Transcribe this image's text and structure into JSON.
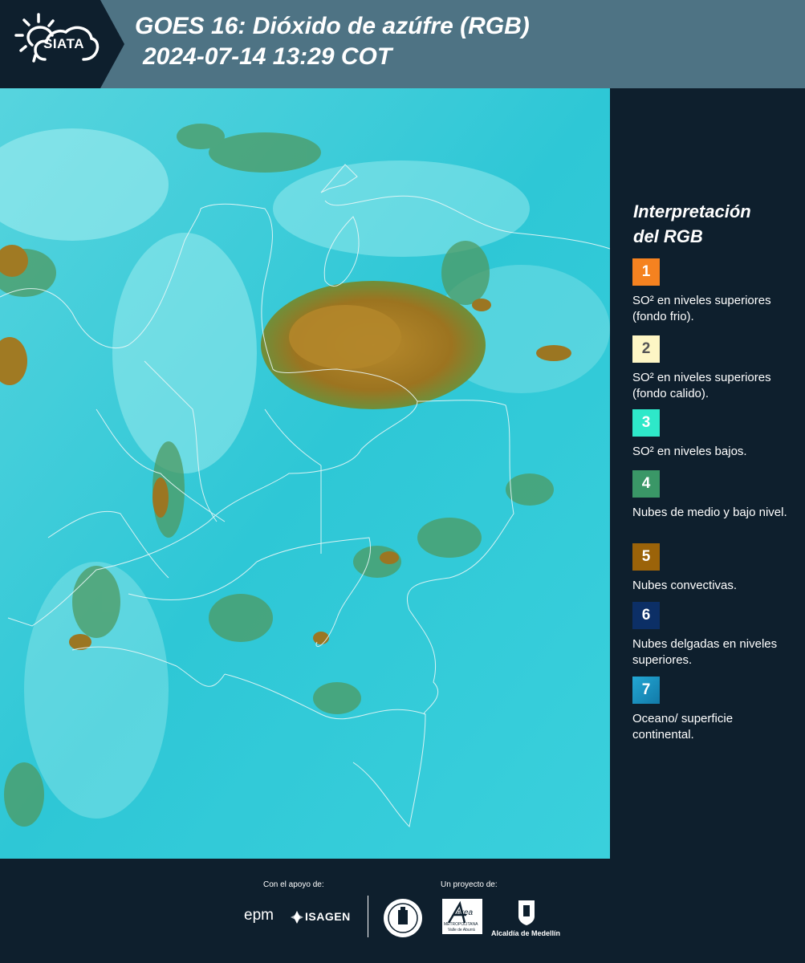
{
  "header": {
    "logo_text": "SIATA",
    "title_line1": "GOES 16: Dióxido de azúfre (RGB)",
    "title_line2": "2024-07-14 13:29 COT"
  },
  "map": {
    "icon": "satellite-map-image"
  },
  "legend": {
    "title_line1": "Interpretación",
    "title_line2": "del RGB",
    "items": [
      {
        "number": "1",
        "text": "SO² en niveles superiores (fondo frio).",
        "color": "#f58220"
      },
      {
        "number": "2",
        "text": "SO² en niveles superiores (fondo calido).",
        "color": "#fdf6c5"
      },
      {
        "number": "3",
        "text": "SO² en niveles bajos.",
        "color": "#2ee8c9"
      },
      {
        "number": "4",
        "text": "Nubes de medio y bajo nivel.",
        "color": "#3a9767"
      },
      {
        "number": "5",
        "text": "Nubes convectivas.",
        "color": "#9b6309"
      },
      {
        "number": "6",
        "text": "Nubes delgadas en niveles superiores.",
        "color": "#0c2f66"
      },
      {
        "number": "7",
        "text": "Oceano/ superficie continental.",
        "color": "#1b8fc2"
      }
    ]
  },
  "footer": {
    "support_label": "Con el apoyo de:",
    "project_label": "Un proyecto de:",
    "epm_logo": "epm",
    "isagen_logo": "ISAGEN",
    "area_logo": "Área",
    "area_sub1": "METROPOLITANA",
    "area_sub2": "Valle de Aburrá",
    "alcaldia_label": "Alcaldía de Medellín"
  }
}
